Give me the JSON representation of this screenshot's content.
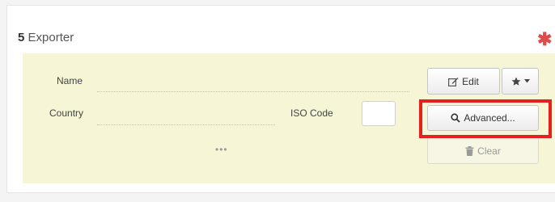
{
  "section": {
    "number": "5",
    "title": "Exporter",
    "required_mark": "✱"
  },
  "fields": {
    "name_label": "Name",
    "country_label": "Country",
    "iso_label": "ISO Code",
    "iso_value": "",
    "more": "•••"
  },
  "buttons": {
    "edit_label": "Edit",
    "advanced_label": "Advanced...",
    "clear_label": "Clear"
  },
  "icons": {
    "edit": "edit-icon",
    "favorites": "star-icon",
    "advanced": "search-icon",
    "clear": "trash-icon"
  },
  "colors": {
    "fields_background": "#f6f5d6",
    "required_mark": "#e04a4a",
    "highlight": "#e52020"
  }
}
